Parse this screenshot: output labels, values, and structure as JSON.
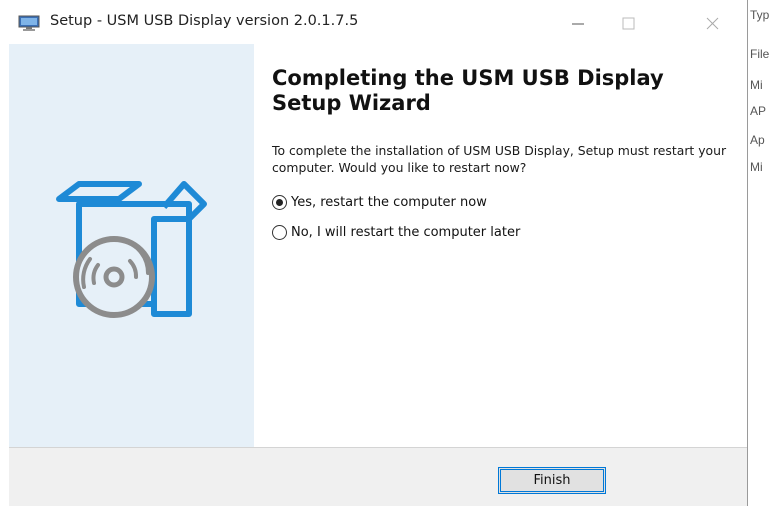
{
  "window": {
    "title": "Setup - USM USB Display version 2.0.1.7.5"
  },
  "wizard": {
    "heading": "Completing the USM USB Display Setup Wizard",
    "description": "To complete the installation of USM USB Display, Setup must restart your computer. Would you like to restart now?",
    "options": [
      {
        "label": "Yes, restart the computer now",
        "selected": true
      },
      {
        "label": "No, I will restart the computer later",
        "selected": false
      }
    ],
    "finish_label": "Finish"
  },
  "background_panel": {
    "items": [
      "Typ",
      "File",
      "Mi",
      "AP",
      "Ap",
      "Mi"
    ]
  },
  "colors": {
    "accent": "#0078d7",
    "sidepanel": "#e6f0f8",
    "icon_blue": "#1e8ad6"
  }
}
